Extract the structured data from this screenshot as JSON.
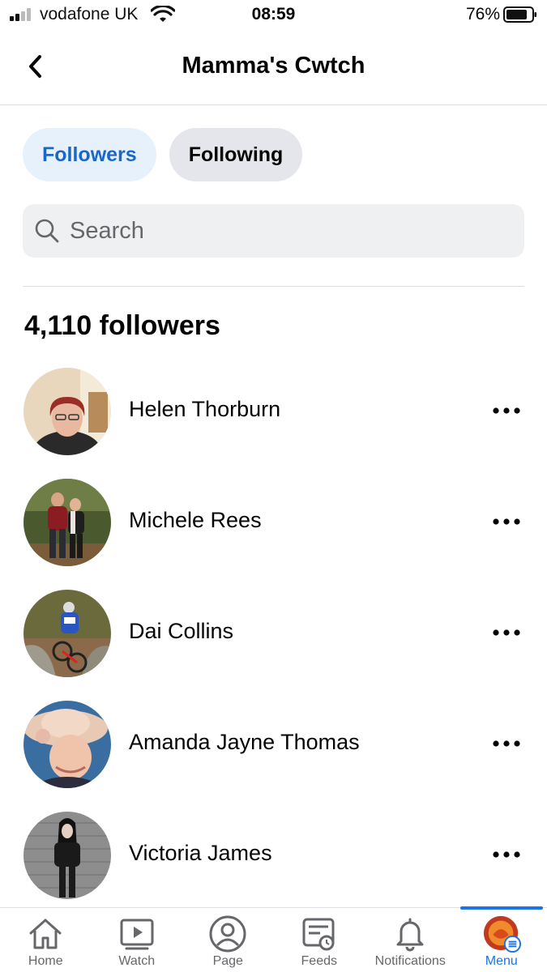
{
  "status_bar": {
    "carrier": "vodafone UK",
    "time": "08:59",
    "battery": "76%",
    "battery_level": 0.76
  },
  "header": {
    "title": "Mamma's Cwtch",
    "back_icon": "chevron-left-icon"
  },
  "tabs": [
    {
      "label": "Followers",
      "active": true
    },
    {
      "label": "Following",
      "active": false
    }
  ],
  "search": {
    "placeholder": "Search",
    "value": ""
  },
  "followers": {
    "count_label": "4,110 followers",
    "items": [
      {
        "name": "Helen Thorburn"
      },
      {
        "name": "Michele Rees"
      },
      {
        "name": "Dai Collins"
      },
      {
        "name": "Amanda Jayne Thomas"
      },
      {
        "name": "Victoria James"
      }
    ]
  },
  "bottom_nav": {
    "items": [
      {
        "label": "Home",
        "icon": "home-icon"
      },
      {
        "label": "Watch",
        "icon": "video-icon"
      },
      {
        "label": "Page",
        "icon": "profile-icon"
      },
      {
        "label": "Feeds",
        "icon": "feeds-icon"
      },
      {
        "label": "Notifications",
        "icon": "bell-icon"
      },
      {
        "label": "Menu",
        "icon": "menu-avatar-icon",
        "active": true
      }
    ]
  },
  "colors": {
    "accent": "#1b74e4",
    "tab_active_bg": "#e7f1fc",
    "tab_inactive_bg": "#e4e6eb"
  }
}
